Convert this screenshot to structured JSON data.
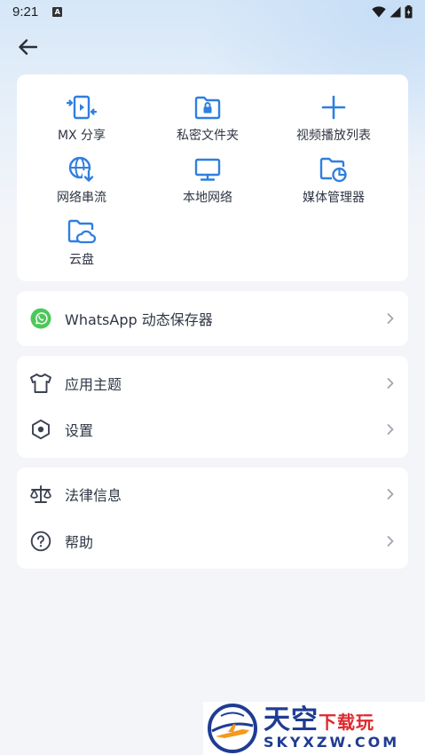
{
  "status_bar": {
    "time": "9:21",
    "notification_glyph": "A"
  },
  "grid": [
    {
      "label": "MX 分享",
      "icon": "share-transfer-icon"
    },
    {
      "label": "私密文件夹",
      "icon": "locked-folder-icon"
    },
    {
      "label": "视频播放列表",
      "icon": "plus-icon"
    },
    {
      "label": "网络串流",
      "icon": "globe-download-icon"
    },
    {
      "label": "本地网络",
      "icon": "monitor-icon"
    },
    {
      "label": "媒体管理器",
      "icon": "folder-chart-icon"
    },
    {
      "label": "云盘",
      "icon": "cloud-folder-icon"
    }
  ],
  "whatsapp": {
    "label": "WhatsApp 动态保存器",
    "icon": "whatsapp-icon"
  },
  "settings_group": [
    {
      "label": "应用主题",
      "icon": "tshirt-icon"
    },
    {
      "label": "设置",
      "icon": "hexagon-settings-icon"
    }
  ],
  "info_group": [
    {
      "label": "法律信息",
      "icon": "scale-icon"
    },
    {
      "label": "帮助",
      "icon": "help-circle-icon"
    }
  ],
  "watermark": {
    "brand": "天空",
    "brand_sub": "下载玩",
    "url": "SKYXZW.COM"
  },
  "colors": {
    "accent": "#2f7fe0",
    "text": "#2f3644",
    "whatsapp": "#4cc85a",
    "icon_gray": "#3b4252"
  }
}
